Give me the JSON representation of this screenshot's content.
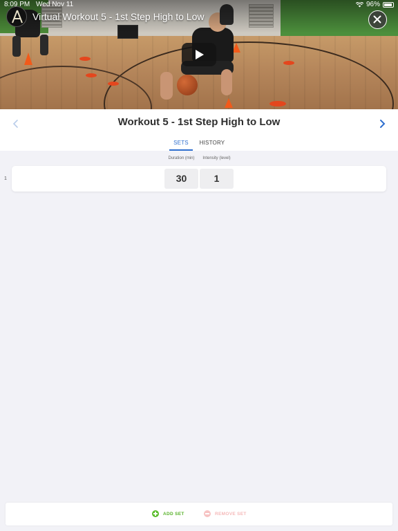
{
  "status_bar": {
    "time": "8:09 PM",
    "date": "Wed Nov 11",
    "battery": "96%"
  },
  "video": {
    "title": "Virtual Workout 5 - 1st Step High to Low",
    "channel_logo_icon": "channel-logo-icon",
    "close_icon": "close-icon",
    "play_icon": "play-icon"
  },
  "header": {
    "title": "Workout 5 - 1st Step High to Low",
    "prev_icon": "chevron-left-icon",
    "next_icon": "chevron-right-icon"
  },
  "tabs": [
    {
      "label": "SETS",
      "active": true
    },
    {
      "label": "HISTORY",
      "active": false
    }
  ],
  "columns": {
    "duration": "Duration (min)",
    "intensity": "Intensity (level)"
  },
  "sets": [
    {
      "index": "1",
      "duration": "30",
      "intensity": "1"
    }
  ],
  "actions": {
    "add_set": "ADD SET",
    "remove_set": "REMOVE SET"
  },
  "colors": {
    "accent_blue": "#2f6fcf",
    "add_green": "#5bbd2c",
    "remove_pink": "#f5b9b9"
  }
}
